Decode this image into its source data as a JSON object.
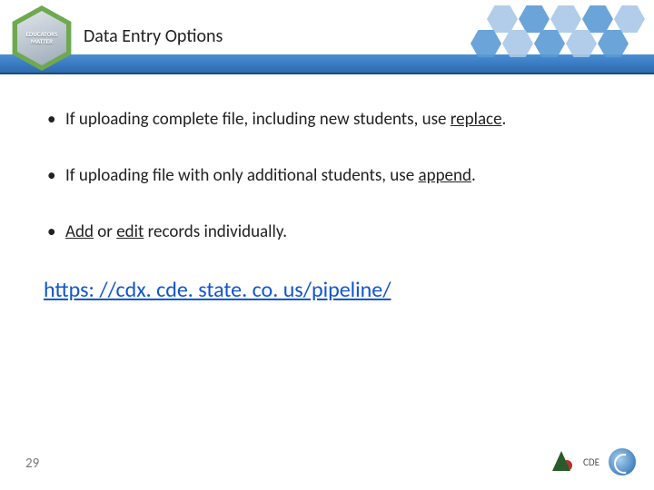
{
  "header": {
    "logo_line1": "EDUCATORS",
    "logo_line2": "MATTER",
    "title": "Data Entry Options"
  },
  "bullets": [
    {
      "pre": "If uploading complete file, including new students, use ",
      "keyword": "replace",
      "post": "."
    },
    {
      "pre": "If uploading file with only additional students, use ",
      "keyword": "append",
      "post": "."
    },
    {
      "pre": "",
      "keyword": "Add",
      "mid": " or ",
      "keyword2": "edit",
      "post": " records individually."
    }
  ],
  "link": "https: //cdx. cde. state. co. us/pipeline/",
  "page_number": "29",
  "footer": {
    "org_abbrev": "CDE"
  }
}
